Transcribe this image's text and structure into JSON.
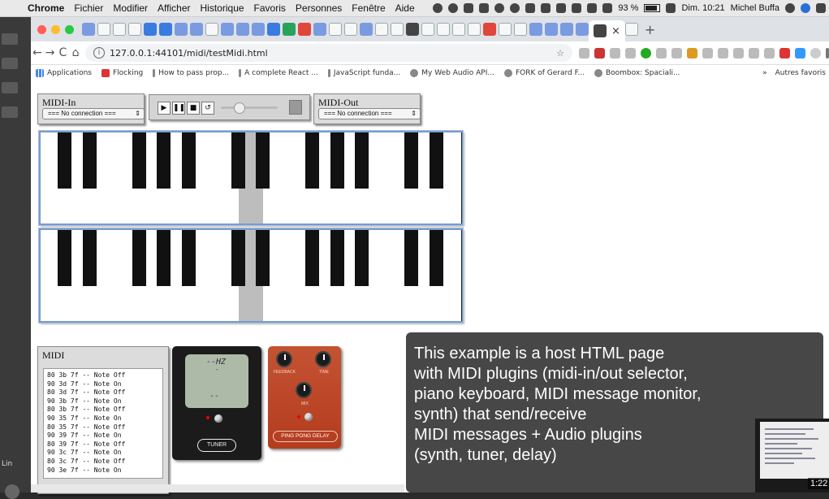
{
  "menubar": {
    "app": "Chrome",
    "items": [
      "Fichier",
      "Modifier",
      "Afficher",
      "Historique",
      "Favoris",
      "Personnes",
      "Fenêtre",
      "Aide"
    ],
    "battery": "93 %",
    "datetime": "Dim. 10:21",
    "user": "Michel Buffa"
  },
  "left_strip": {
    "label": "Lin"
  },
  "browser": {
    "close_tab": "×",
    "new_tab": "+",
    "url": "127.0.0.1:44101/midi/testMidi.html",
    "nav": {
      "back": "←",
      "forward": "→",
      "reload": "C",
      "home": "⌂",
      "star": "☆"
    },
    "bookmarks": [
      {
        "label": "Applications",
        "icon": "apps-grid-icon"
      },
      {
        "label": "Flocking",
        "icon": "bookmark-icon"
      },
      {
        "label": "How to pass prop...",
        "icon": "bookmark-icon"
      },
      {
        "label": "A complete React ...",
        "icon": "bookmark-icon"
      },
      {
        "label": "JavaScript funda...",
        "icon": "bookmark-icon"
      },
      {
        "label": "My Web Audio API...",
        "icon": "bookmark-icon"
      },
      {
        "label": "FORK of Gerard F...",
        "icon": "bookmark-icon"
      },
      {
        "label": "Boombox: Spaciali...",
        "icon": "bookmark-icon"
      }
    ],
    "bookmarks_more": "»",
    "other_bookmarks": "Autres favoris"
  },
  "midi_in": {
    "title": "MIDI-In",
    "select_value": "=== No connection ==="
  },
  "midi_out": {
    "title": "MIDI-Out",
    "select_value": "=== No connection ==="
  },
  "transport": {
    "play": "▶",
    "pause": "❚❚",
    "stop": "■",
    "loop": "↺"
  },
  "pianos": {
    "white_keys": 17,
    "pressed_white_index": 8
  },
  "monitor": {
    "title": "MIDI",
    "lines": [
      "80 3b 7f -- Note Off",
      "90 3d 7f -- Note On",
      "80 3d 7f -- Note Off",
      "90 3b 7f -- Note On",
      "80 3b 7f -- Note Off",
      "90 35 7f -- Note On",
      "80 35 7f -- Note Off",
      "90 39 7f -- Note On",
      "80 39 7f -- Note Off",
      "90 3c 7f -- Note On",
      "80 3c 7f -- Note Off",
      "90 3e 7f -- Note On"
    ]
  },
  "tuner": {
    "hz": "--HZ",
    "tick": "-",
    "value": "--",
    "label": "TUNER"
  },
  "delay": {
    "feedback": "FEEDBACK",
    "time": "TIME",
    "mix": "MIX",
    "label": "PING PONG DELAY"
  },
  "caption": {
    "lines": [
      "This example is a host HTML page",
      "with MIDI plugins (midi-in/out selector,",
      "piano keyboard, MIDI message monitor,",
      "synth) that send/receive",
      "MIDI messages + Audio plugins",
      "(synth, tuner, delay)"
    ]
  },
  "video": {
    "timestamp": "1:22"
  }
}
